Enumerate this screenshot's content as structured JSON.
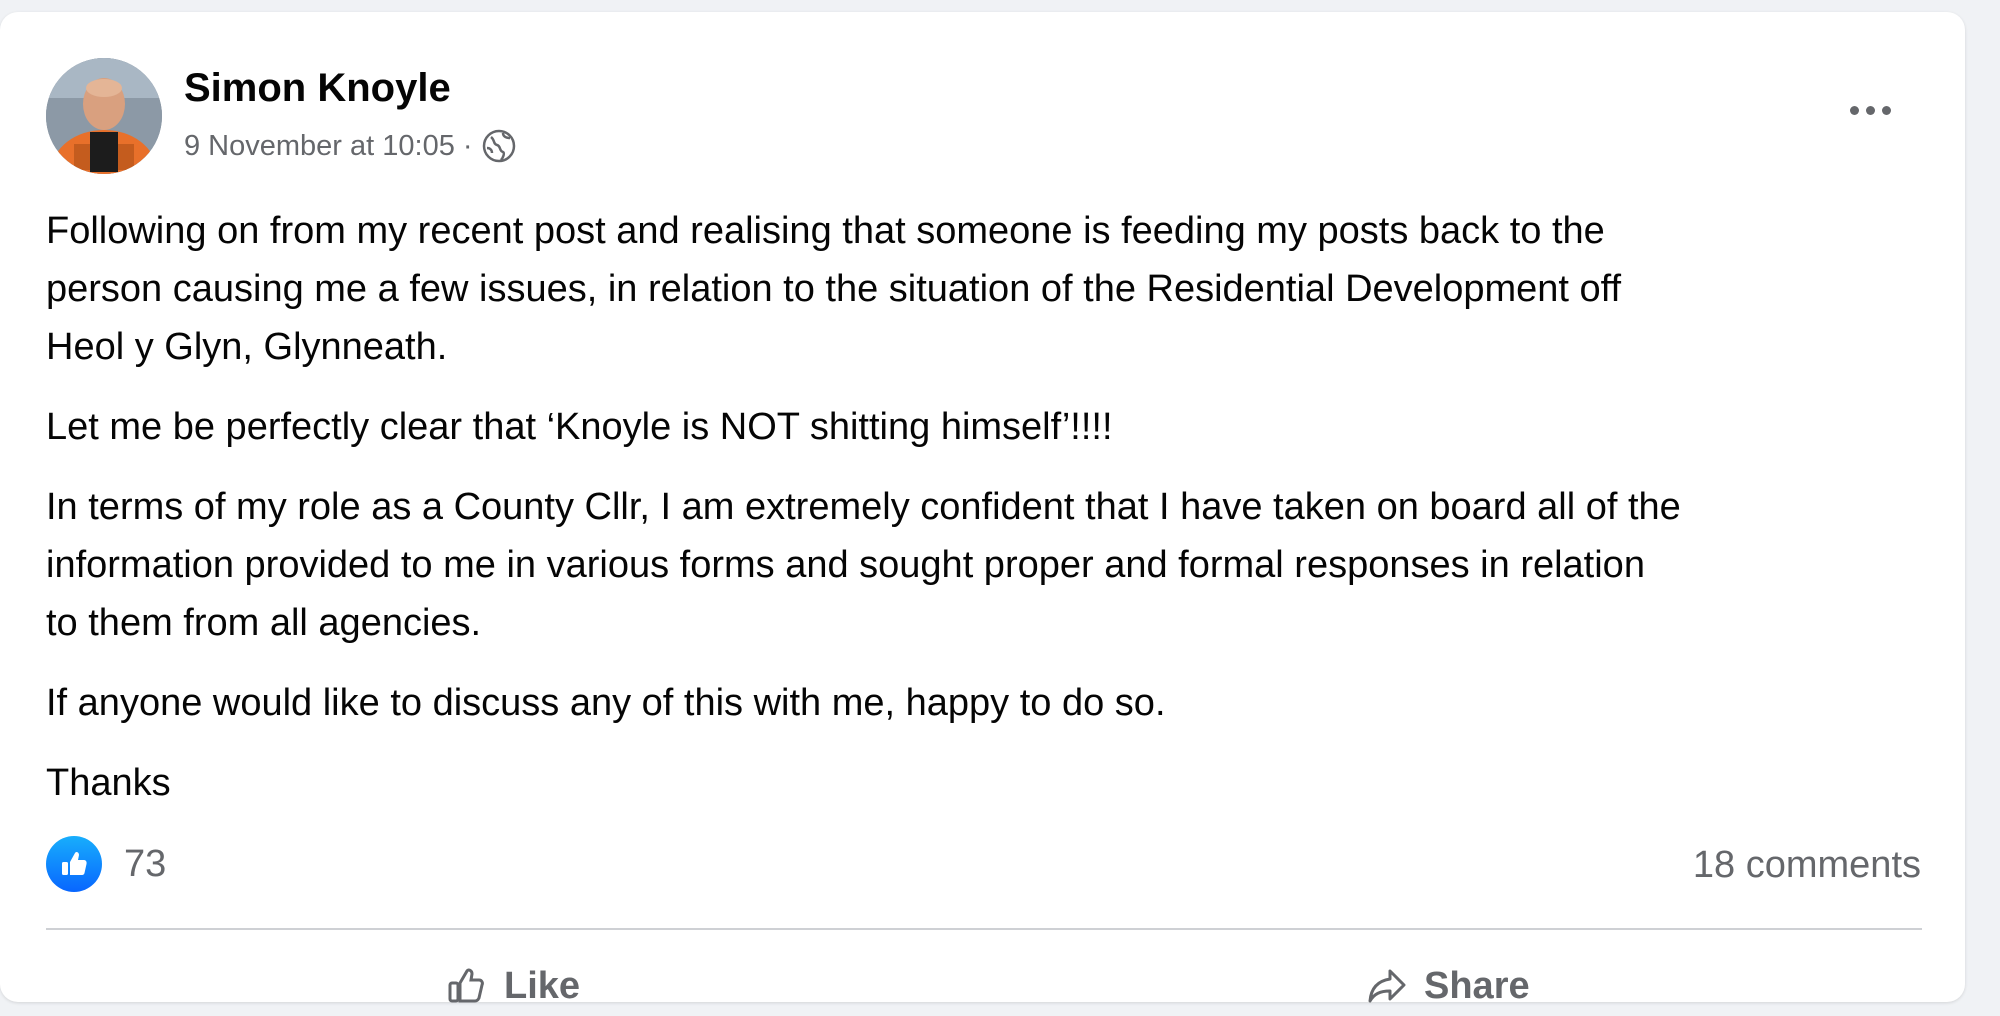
{
  "post": {
    "author": "Simon Knoyle",
    "timestamp": "9 November at 10:05",
    "separator": "·",
    "audience_icon": "globe-icon",
    "menu_icon": "more-options-icon",
    "paragraphs": [
      "Following on from my recent post and realising that someone is feeding my posts back to the\nperson causing me a few issues, in relation to the situation of the Residential Development off\nHeol y Glyn, Glynneath.",
      "Let me be perfectly clear that ‘Knoyle is NOT shitting himself’!!!!",
      "In terms of my role as a County Cllr, I am extremely confident that I have taken on board all of the\ninformation provided to me in various forms and sought proper and formal responses in relation\nto them from all agencies.",
      "If anyone would like to discuss any of this with me, happy to do so.",
      "Thanks"
    ]
  },
  "reactions": {
    "icon": "like-reaction-icon",
    "count": "73",
    "comments": "18 comments"
  },
  "actions": {
    "like_label": "Like",
    "share_label": "Share"
  },
  "colors": {
    "like_blue": "#0866ff",
    "secondary_text": "#65676b",
    "page_background": "#f0f2f5"
  }
}
